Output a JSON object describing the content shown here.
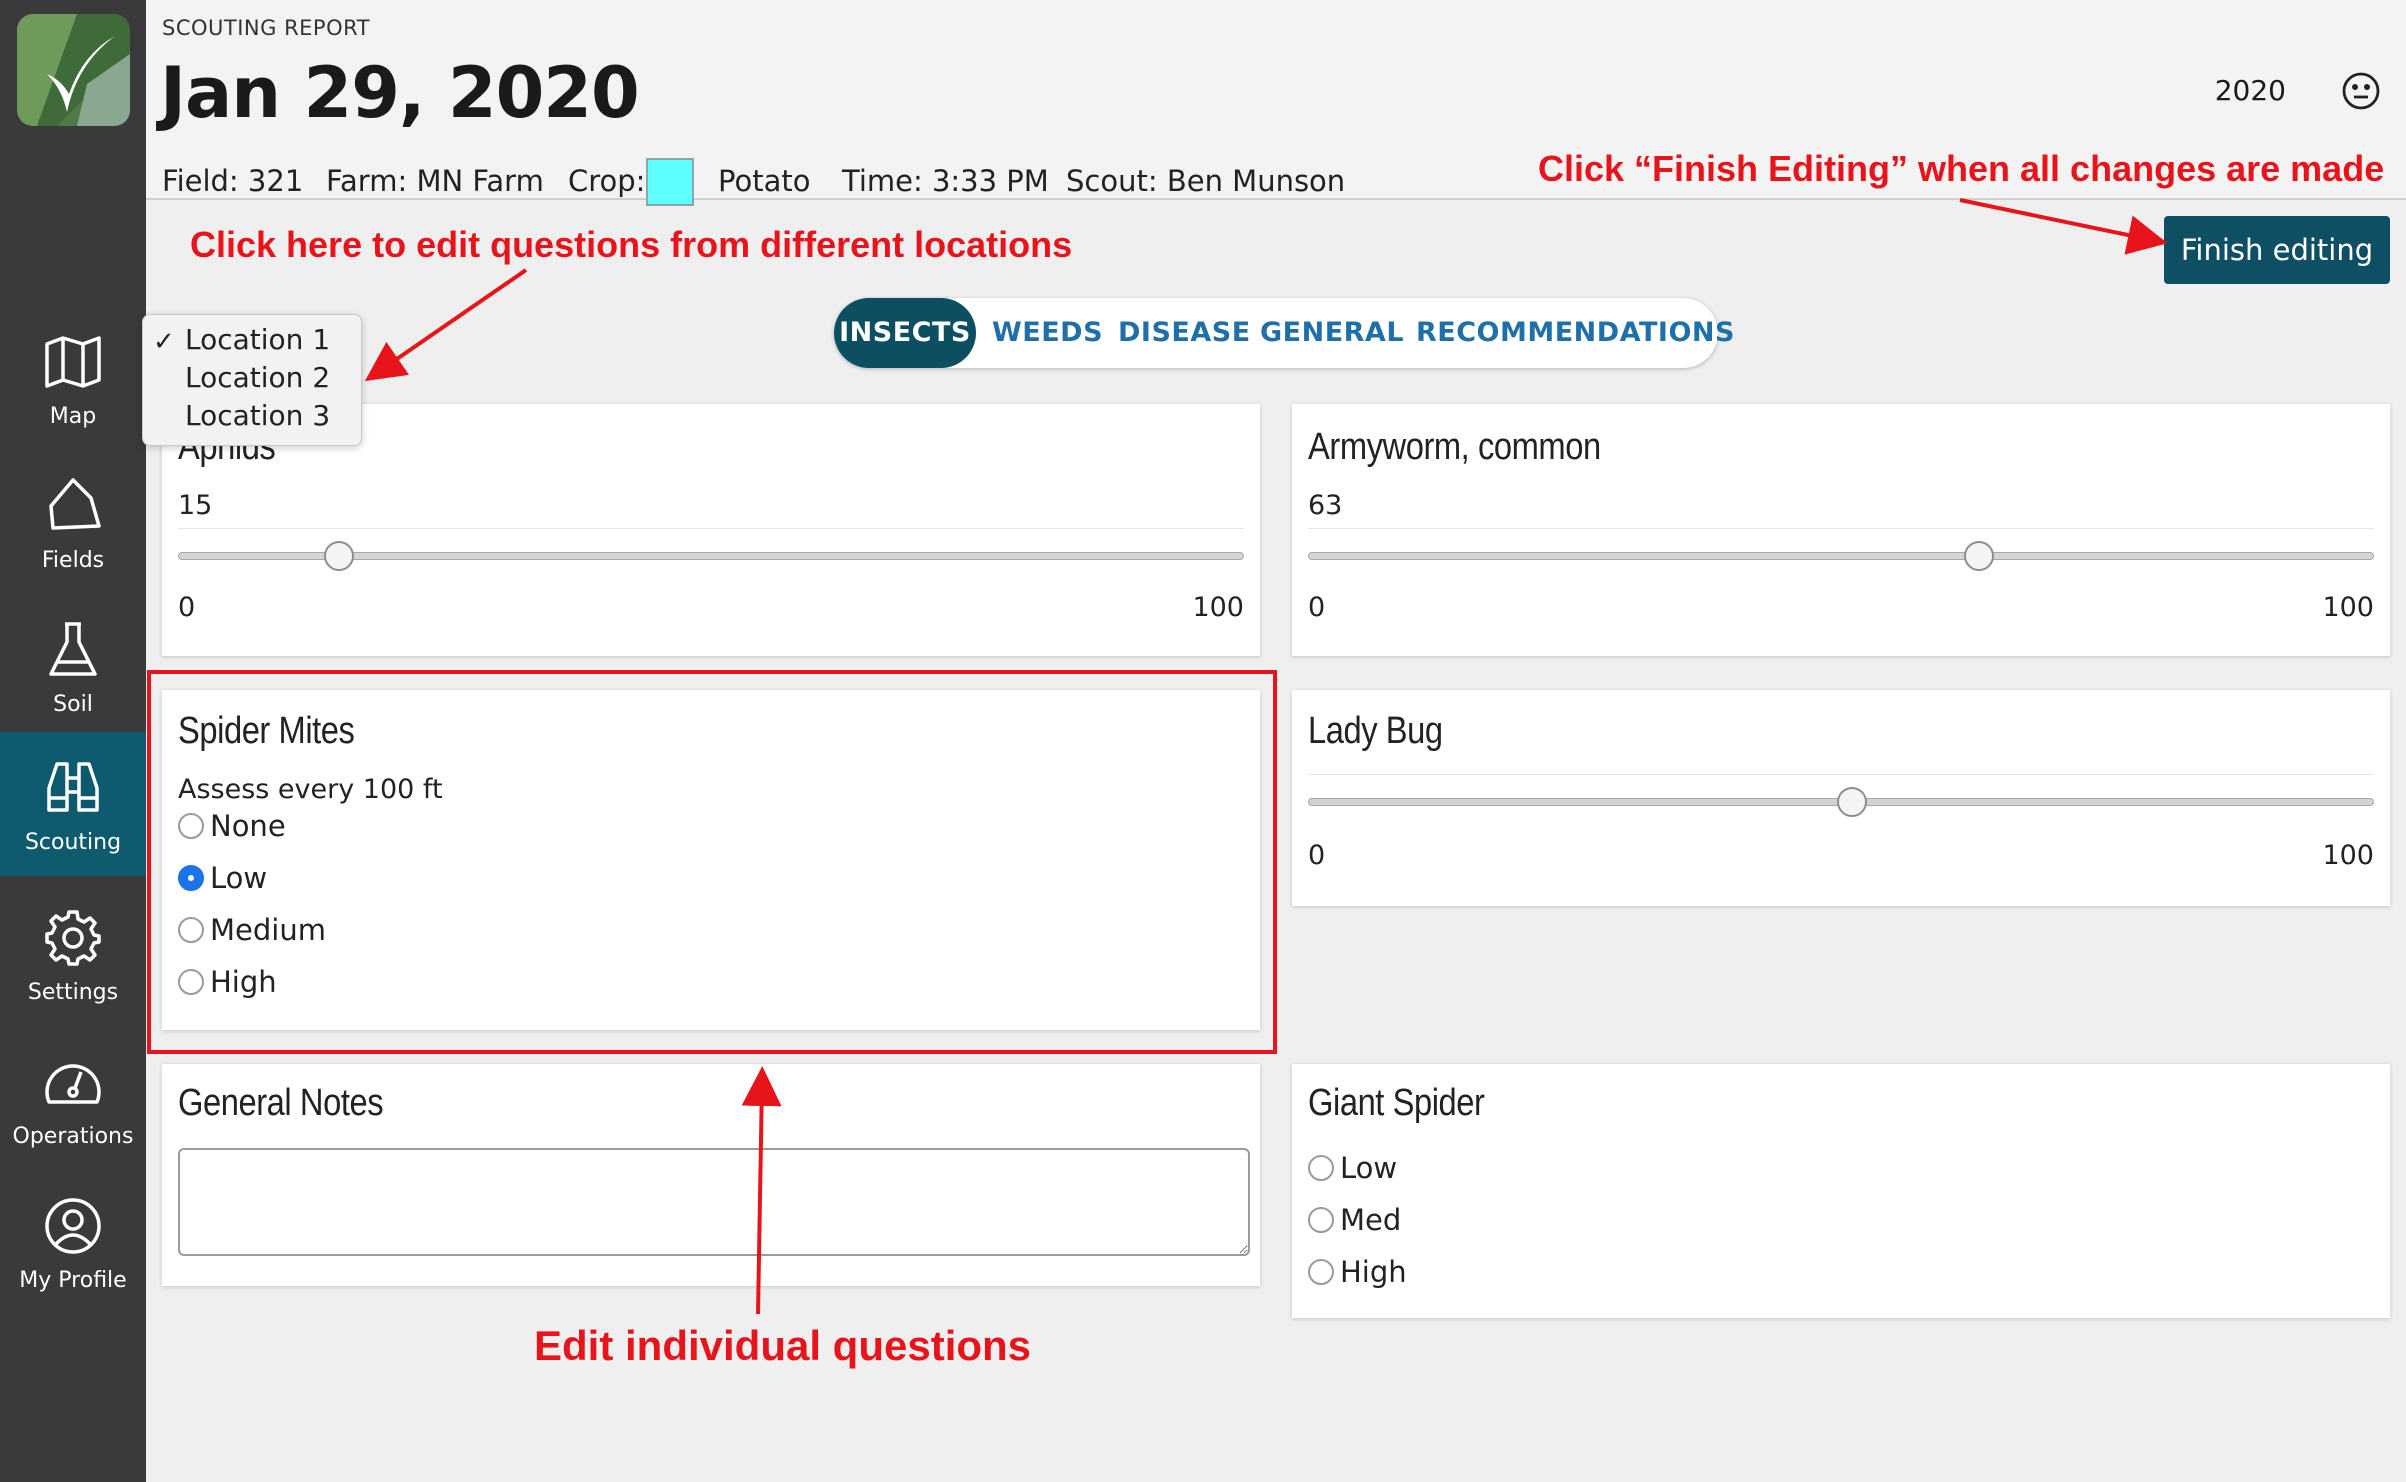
{
  "sidebar": {
    "items": [
      {
        "label": "Map",
        "icon": "map-icon"
      },
      {
        "label": "Fields",
        "icon": "field-icon"
      },
      {
        "label": "Soil",
        "icon": "flask-icon"
      },
      {
        "label": "Scouting",
        "icon": "binoculars-icon",
        "active": true
      },
      {
        "label": "Settings",
        "icon": "gear-icon"
      },
      {
        "label": "Operations",
        "icon": "gauge-icon"
      },
      {
        "label": "My Profile",
        "icon": "user-icon"
      }
    ]
  },
  "header": {
    "kicker": "SCOUTING REPORT",
    "title": "Jan 29, 2020",
    "year": "2020",
    "field": "Field: 321",
    "farm": "Farm: MN Farm",
    "crop_label": "Crop:",
    "crop_color": "#5fffff",
    "crop": "Potato",
    "time": "Time: 3:33 PM",
    "scout": "Scout: Ben Munson"
  },
  "annotations": {
    "finish": "Click “Finish Editing” when all changes are made",
    "locations": "Click here to edit questions from different locations",
    "questions": "Edit individual questions"
  },
  "finish_button": "Finish editing",
  "tabs": [
    {
      "label": "INSECTS",
      "active": true
    },
    {
      "label": "WEEDS"
    },
    {
      "label": "DISEASE"
    },
    {
      "label": "GENERAL"
    },
    {
      "label": "RECOMMENDATIONS"
    }
  ],
  "location_menu": {
    "check": "✓",
    "options": [
      "Location 1",
      "Location 2",
      "Location 3"
    ],
    "selected": "Location 1"
  },
  "cards": {
    "aphids": {
      "title": "Aphids",
      "value": "15",
      "min": "0",
      "max": "100",
      "level": 15
    },
    "armyworm": {
      "title": "Armyworm, common",
      "value": "63",
      "min": "0",
      "max": "100",
      "level": 63
    },
    "spider_mites": {
      "title": "Spider Mites",
      "subtitle": "Assess every 100 ft",
      "options": [
        "None",
        "Low",
        "Medium",
        "High"
      ],
      "selected": "Low"
    },
    "lady_bug": {
      "title": "Lady Bug",
      "min": "0",
      "max": "100",
      "level": 51
    },
    "general_notes": {
      "title": "General Notes",
      "value": ""
    },
    "giant_spider": {
      "title": "Giant Spider",
      "options": [
        "Low",
        "Med",
        "High"
      ],
      "selected": null
    }
  },
  "colors": {
    "sidebar": "#3a3a3c",
    "sidebar_active": "#0e5a6e",
    "accent": "#0b4f61",
    "tab_text": "#1f6fa8",
    "annotation": "#e8141b",
    "radio_checked": "#1a73e8"
  }
}
